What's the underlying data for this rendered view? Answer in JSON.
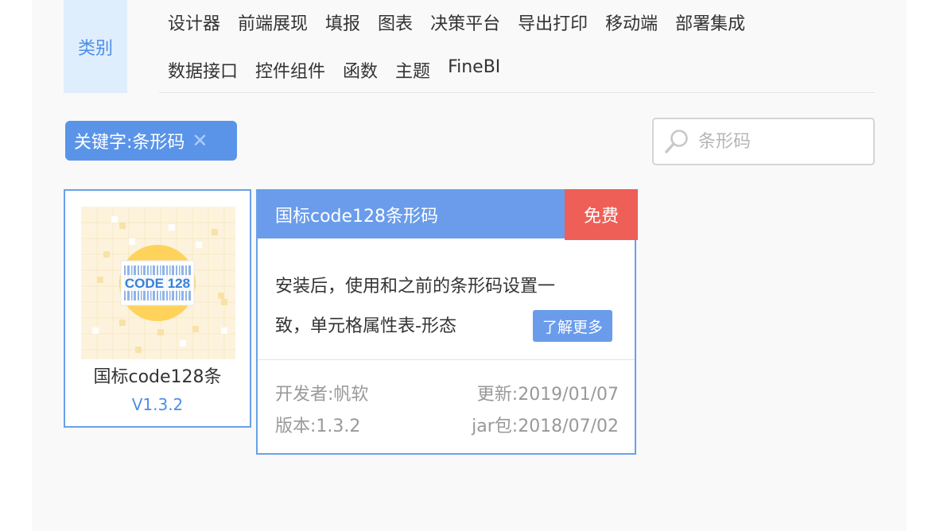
{
  "categories": {
    "label": "类别",
    "row1": [
      "设计器",
      "前端展现",
      "填报",
      "图表",
      "决策平台",
      "导出打印",
      "移动端",
      "部署集成"
    ],
    "row2": [
      "数据接口",
      "控件组件",
      "函数",
      "主题",
      "FineBI"
    ]
  },
  "filter": {
    "keyword_tag": "关键字:条形码",
    "close_icon": "close-icon"
  },
  "search": {
    "placeholder": "条形码",
    "icon": "search-icon"
  },
  "plugin": {
    "thumbnail_text": "CODE 128",
    "name": "国标code128条",
    "version": "V1.3.2"
  },
  "detail": {
    "title": "国标code128条形码",
    "badge": "免费",
    "description_line1": "安装后，使用和之前的条形码设置一",
    "description_line2": "致，单元格属性表-形态",
    "more_button": "了解更多",
    "developer": "开发者:帆软",
    "updated": "更新:2019/01/07",
    "version": "版本:1.3.2",
    "jar": "jar包:2018/07/02"
  },
  "colors": {
    "accent": "#5a94e8",
    "header": "#6a9ceb",
    "free": "#ee5f57",
    "category_bg": "#dfeefc"
  }
}
